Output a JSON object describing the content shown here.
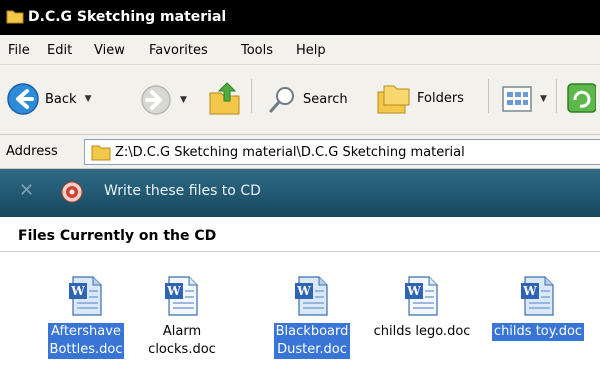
{
  "window": {
    "title": "D.C.G Sketching material"
  },
  "menu": [
    "File",
    "Edit",
    "View",
    "Favorites",
    "Tools",
    "Help"
  ],
  "toolbar": {
    "back_label": "Back",
    "search_label": "Search",
    "folders_label": "Folders"
  },
  "address": {
    "label": "Address",
    "path": "Z:\\D.C.G Sketching material\\D.C.G Sketching material"
  },
  "cd_task": {
    "label": "Write these files to CD"
  },
  "section": {
    "heading": "Files Currently on the CD"
  },
  "files": [
    {
      "name": "Aftershave Bottles.doc",
      "line1": "Aftershave",
      "line2": "Bottles.doc",
      "selected": true
    },
    {
      "name": "Alarm clocks.doc",
      "line1": "Alarm",
      "line2": "clocks.doc",
      "selected": false
    },
    {
      "name": "Blackboard Duster.doc",
      "line1": "Blackboard",
      "line2": "Duster.doc",
      "selected": true
    },
    {
      "name": "childs lego.doc",
      "line1": "childs lego.doc",
      "line2": "",
      "selected": false
    },
    {
      "name": "childs toy.doc",
      "line1": "childs toy.doc",
      "line2": "",
      "selected": true
    }
  ],
  "colors": {
    "selection": "#3875d7",
    "cd_bar": "#245a74",
    "titlebar": "#000000"
  }
}
